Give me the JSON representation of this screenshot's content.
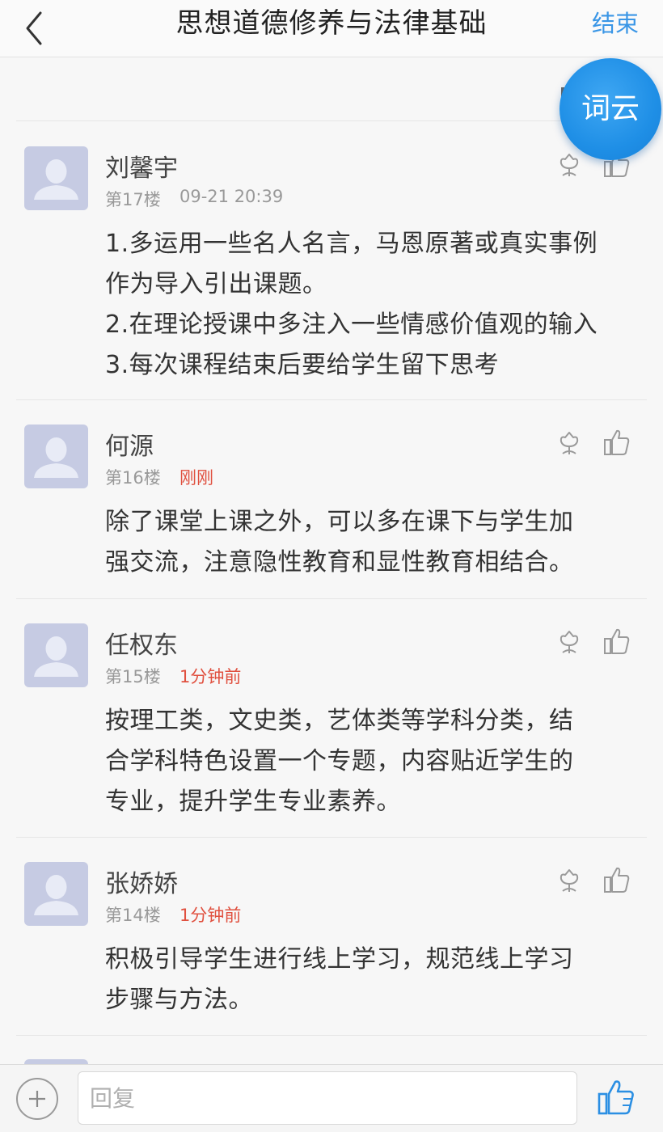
{
  "header": {
    "title": "思想道德修养与法律基础",
    "end_label": "结束"
  },
  "cloud_button": {
    "label": "词云"
  },
  "posts": [
    {
      "name": "刘馨宇",
      "floor": "第17楼",
      "time": "09-21 20:39",
      "time_recent": false,
      "content": "1.多运用一些名人名言，马恩原著或真实事例\n作为导入引出课题。\n2.在理论授课中多注入一些情感价值观的输入\n3.每次课程结束后要给学生留下思考"
    },
    {
      "name": "何源",
      "floor": "第16楼",
      "time": "刚刚",
      "time_recent": true,
      "content": "除了课堂上课之外，可以多在课下与学生加\n强交流，注意隐性教育和显性教育相结合。"
    },
    {
      "name": "任权东",
      "floor": "第15楼",
      "time": "1分钟前",
      "time_recent": true,
      "content": "按理工类，文史类，艺体类等学科分类，结\n合学科特色设置一个专题，内容贴近学生的\n专业，提升学生专业素养。"
    },
    {
      "name": "张娇娇",
      "floor": "第14楼",
      "time": "1分钟前",
      "time_recent": true,
      "content": "积极引导学生进行线上学习，规范线上学习\n步骤与方法。"
    }
  ],
  "footer": {
    "reply_placeholder": "回复"
  },
  "colors": {
    "accent": "#3a96e6",
    "recent_time": "#e0503f",
    "avatar_bg": "#c6cbe3"
  },
  "icons": {
    "back": "chevron-left-icon",
    "flower": "flower-icon",
    "like": "thumbs-up-icon",
    "add": "plus-icon"
  }
}
